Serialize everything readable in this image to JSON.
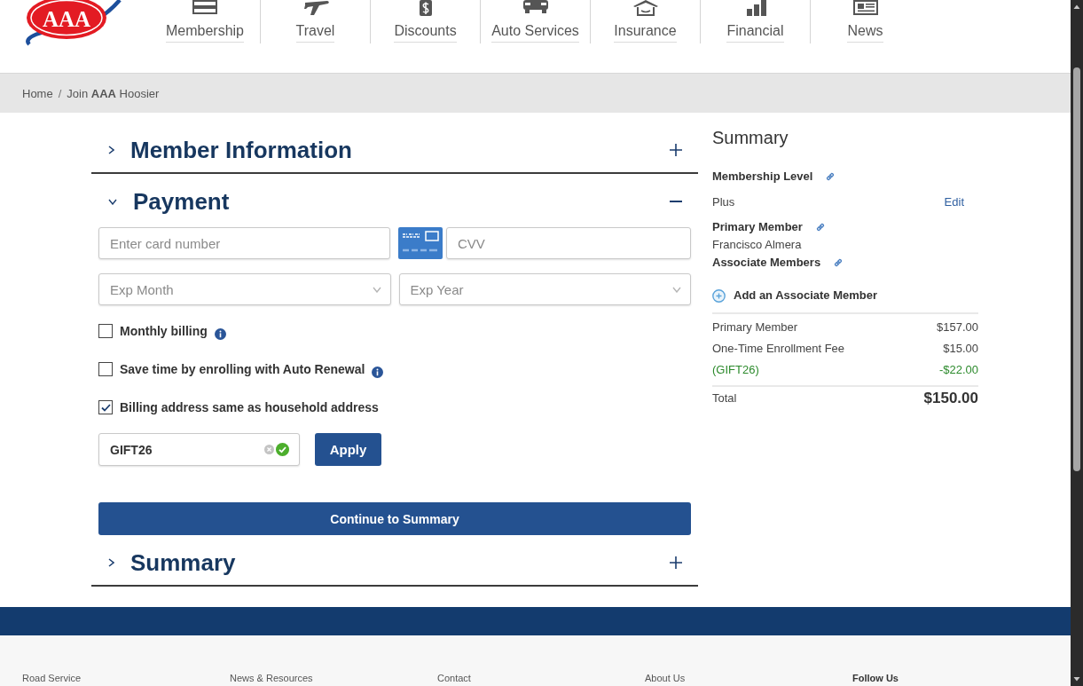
{
  "logo": {
    "text": "AAA"
  },
  "nav": [
    "Membership",
    "Travel",
    "Discounts",
    "Auto Services",
    "Insurance",
    "Financial",
    "News"
  ],
  "breadcrumb": {
    "items": [
      "Home",
      "Join **AAA** Hoosier"
    ],
    "separator": "/"
  },
  "sections": [
    {
      "title": "Member Information",
      "expanded": false
    },
    {
      "title": "Payment",
      "expanded": true
    },
    {
      "title": "Summary",
      "expanded": false
    }
  ],
  "payment": {
    "card_number": {
      "placeholder": "Enter card number"
    },
    "cvv": {
      "placeholder": "CVV"
    },
    "exp_month": {
      "placeholder": "Exp Month"
    },
    "exp_year": {
      "placeholder": "Exp Year"
    },
    "options": [
      {
        "label": "Monthly billing",
        "checked": false,
        "info": true
      },
      {
        "label": "Save time by enrolling with Auto Renewal",
        "checked": false,
        "info": true
      },
      {
        "label": "Billing address same as household address",
        "checked": true,
        "info": false
      }
    ],
    "promo_code": {
      "value": "GIFT26",
      "valid": true
    },
    "apply_button": "Apply",
    "continue_button": "Continue to Summary"
  },
  "summary": {
    "title": "Summary",
    "membership_level": {
      "label": "Membership Level",
      "value": "Plus",
      "action": "Edit"
    },
    "primary_member": {
      "label": "Primary Member",
      "value": "Francisco Almera"
    },
    "associate_members": {
      "label": "Associate Members"
    },
    "add_associate": "Add an Associate Member",
    "lines": [
      {
        "label": "Primary Member",
        "amount": "$157.00",
        "kind": "charge"
      },
      {
        "label": "One-Time Enrollment Fee",
        "amount": "$15.00",
        "kind": "charge"
      },
      {
        "label": "(GIFT26)",
        "amount": "-$22.00",
        "kind": "discount"
      }
    ],
    "total": {
      "label": "Total",
      "amount": "$150.00"
    }
  },
  "footer": {
    "columns": [
      {
        "label": "Road Service",
        "kind": "link"
      },
      {
        "label": "News & Resources",
        "kind": "link"
      },
      {
        "label": "Contact",
        "kind": "link"
      },
      {
        "label": "About Us",
        "kind": "link"
      },
      {
        "label": "Follow Us",
        "kind": "heading"
      }
    ]
  }
}
